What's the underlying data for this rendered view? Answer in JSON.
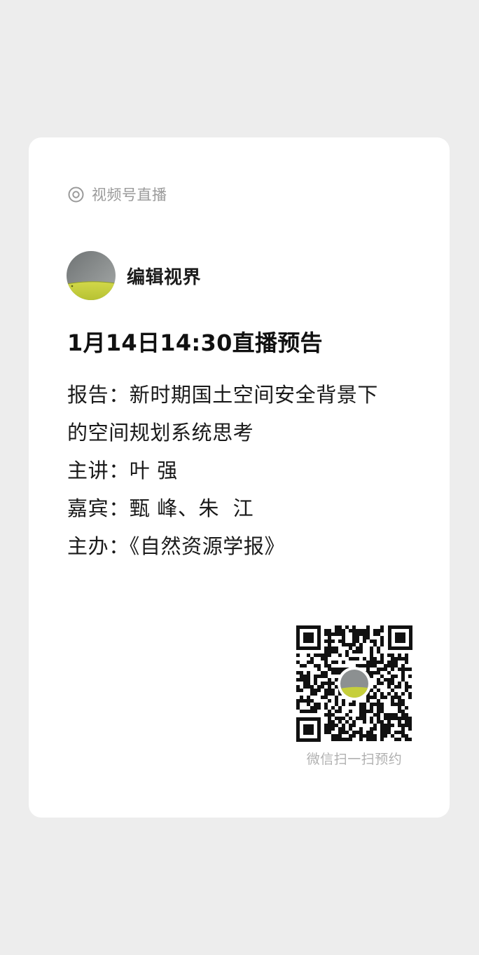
{
  "source": {
    "label": "视频号直播",
    "icon": "live-channel-icon"
  },
  "account": {
    "name": "编辑视界",
    "avatar": "account-avatar-image"
  },
  "live": {
    "title": "1月14日14:30直播预告"
  },
  "description": {
    "lines": [
      "报告：新时期国土空间安全背景下",
      "的空间规划系统思考",
      "主讲：叶 强",
      "嘉宾：甄 峰、朱  江",
      "主办：《自然资源学报》"
    ]
  },
  "qr": {
    "caption": "微信扫一扫预约"
  },
  "colors": {
    "background": "#ededed",
    "card": "#ffffff",
    "muted_text": "#9a9a9a",
    "avatar_sky": "#8a8e8f",
    "avatar_field": "#c6cf3c"
  }
}
